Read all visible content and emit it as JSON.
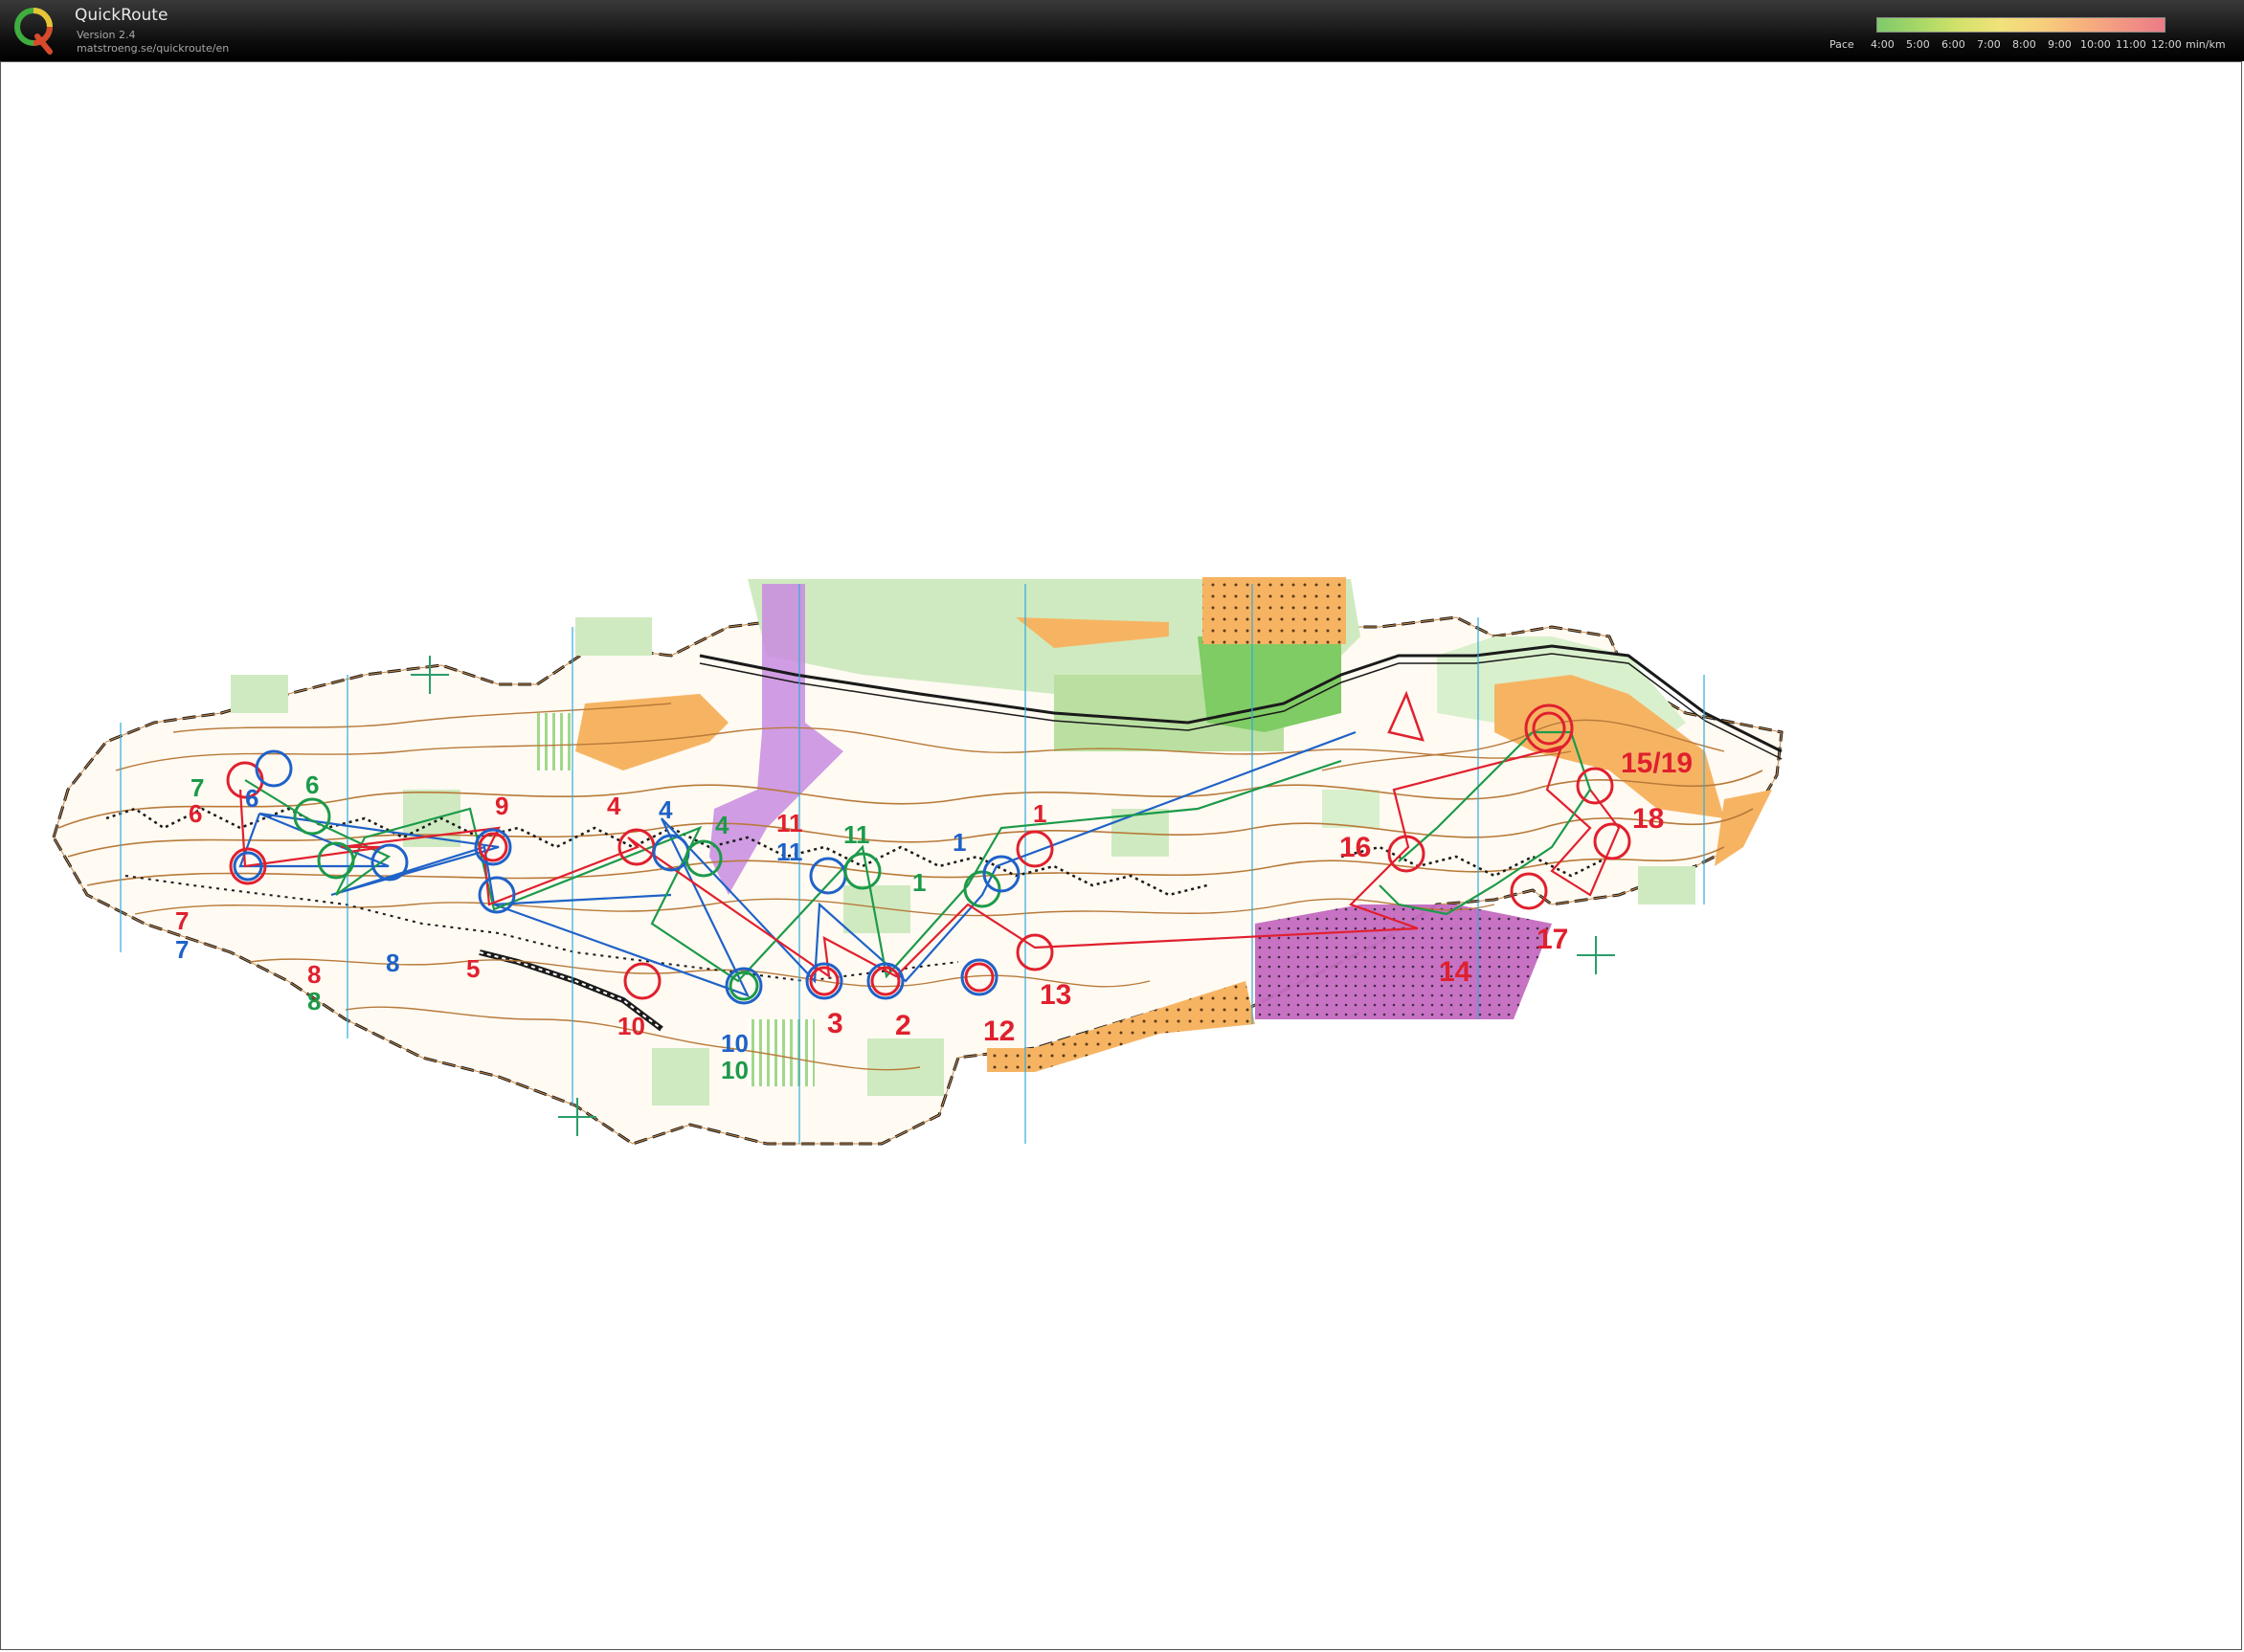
{
  "app": {
    "name": "QuickRoute",
    "version": "Version 2.4",
    "url": "matstroeng.se/quickroute/en",
    "logo_letter": "Q"
  },
  "pace_legend": {
    "title": "Pace",
    "ticks": [
      "4:00",
      "5:00",
      "6:00",
      "7:00",
      "8:00",
      "9:00",
      "10:00",
      "11:00",
      "12:00"
    ],
    "unit": "min/km",
    "colors": [
      "#7fc96b",
      "#a6d866",
      "#d3e26a",
      "#f1e27a",
      "#f7cf7c",
      "#f7b27c",
      "#f29584",
      "#ec7b86"
    ]
  },
  "map": {
    "colors": {
      "red": "#e0202e",
      "blue": "#1f62c8",
      "green": "#1c9a4a",
      "purple": "#c77bd4",
      "open": "#f6b463",
      "forest": "#9fd585",
      "contour": "#b87a3a"
    },
    "control_labels": [
      {
        "text": "7",
        "color": "green"
      },
      {
        "text": "6",
        "color": "red"
      },
      {
        "text": "6",
        "color": "blue"
      },
      {
        "text": "6",
        "color": "green"
      },
      {
        "text": "9",
        "color": "red"
      },
      {
        "text": "4",
        "color": "red"
      },
      {
        "text": "4",
        "color": "blue"
      },
      {
        "text": "4",
        "color": "green"
      },
      {
        "text": "11",
        "color": "red"
      },
      {
        "text": "11",
        "color": "blue"
      },
      {
        "text": "11",
        "color": "green"
      },
      {
        "text": "1",
        "color": "blue"
      },
      {
        "text": "1",
        "color": "red"
      },
      {
        "text": "1",
        "color": "green"
      },
      {
        "text": "7",
        "color": "red"
      },
      {
        "text": "7",
        "color": "blue"
      },
      {
        "text": "8",
        "color": "red"
      },
      {
        "text": "8",
        "color": "green"
      },
      {
        "text": "8",
        "color": "blue"
      },
      {
        "text": "5",
        "color": "red"
      },
      {
        "text": "10",
        "color": "red"
      },
      {
        "text": "10",
        "color": "blue"
      },
      {
        "text": "10",
        "color": "green"
      },
      {
        "text": "3",
        "color": "red"
      },
      {
        "text": "2",
        "color": "red"
      },
      {
        "text": "12",
        "color": "red"
      },
      {
        "text": "13",
        "color": "red"
      },
      {
        "text": "14",
        "color": "red"
      },
      {
        "text": "15/19",
        "color": "red"
      },
      {
        "text": "16",
        "color": "red"
      },
      {
        "text": "17",
        "color": "red"
      },
      {
        "text": "18",
        "color": "red"
      }
    ]
  }
}
